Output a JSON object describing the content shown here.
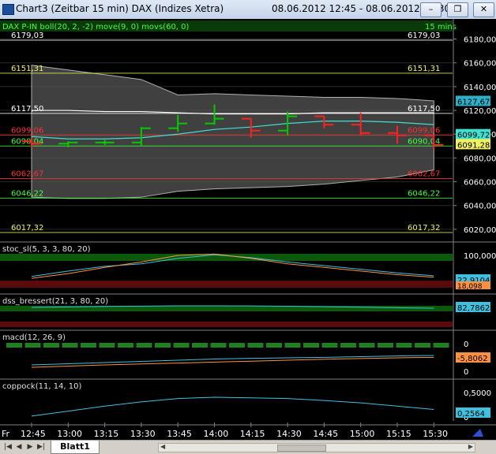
{
  "window": {
    "title": "Chart3 (Zeitbar 15 min)  DAX (Indizes Xetra)",
    "range": "08.06.2012 12:45 - 08.06.2012 15:30",
    "minimize_glyph": "–",
    "restore_glyph": "❐",
    "close_glyph": "✕"
  },
  "chart_header": {
    "label": "DAX P-IN  boll(20, 2, -2) move(9, 0) movs(60, 0)",
    "interval": "15 mins"
  },
  "colors": {
    "bg": "#000000",
    "grid": "#2a2a2a",
    "axis_text": "#ffffff",
    "up_bar": "#00cc00",
    "down_bar": "#ff2020",
    "boll_fill": "#555555",
    "ma9": "#40e0d0",
    "ma60": "#ffffff",
    "green_osc": "#0a5a0a",
    "red_osc": "#5a0a0a",
    "osc_cyan": "#40c0e0",
    "osc_orange": "#ff9040"
  },
  "chart_data": {
    "type": "candlestick",
    "x": [
      "12:45",
      "13:00",
      "13:15",
      "13:30",
      "13:45",
      "14:00",
      "14:15",
      "14:30",
      "14:45",
      "15:00",
      "15:15",
      "15:30"
    ],
    "ohlc": [
      [
        6094,
        6097,
        6089,
        6092
      ],
      [
        6092,
        6094,
        6089,
        6093
      ],
      [
        6093,
        6095,
        6091,
        6093
      ],
      [
        6093,
        6106,
        6090,
        6105
      ],
      [
        6105,
        6116,
        6102,
        6109
      ],
      [
        6109,
        6125,
        6108,
        6113
      ],
      [
        6113,
        6113,
        6097,
        6103
      ],
      [
        6103,
        6119,
        6099,
        6115
      ],
      [
        6115,
        6115,
        6105,
        6108
      ],
      [
        6108,
        6118,
        6099,
        6101
      ],
      [
        6101,
        6107,
        6092,
        6099
      ],
      [
        6099,
        6099,
        6088,
        6091
      ]
    ],
    "ylim": [
      6010,
      6185
    ],
    "y_ticks": [
      6020,
      6040,
      6060,
      6080,
      6100,
      6120,
      6140,
      6160,
      6180
    ],
    "y_tick_labels": [
      "6020,00",
      "6040,00",
      "6060,00",
      "6080,00",
      "6100,00",
      "6120,00",
      "6140,00",
      "6160,00",
      "6180,00"
    ],
    "boll_upper": [
      6158,
      6154,
      6150,
      6146,
      6133,
      6134,
      6133,
      6132,
      6131,
      6131,
      6130,
      6128
    ],
    "boll_lower": [
      6047,
      6046,
      6046,
      6047,
      6052,
      6054,
      6055,
      6056,
      6058,
      6061,
      6064,
      6070
    ],
    "ma9": [
      6098,
      6096,
      6096,
      6097,
      6100,
      6104,
      6106,
      6109,
      6111,
      6111,
      6110,
      6108
    ],
    "ma60": [
      6120,
      6120,
      6119,
      6119,
      6118,
      6117,
      6117,
      6117,
      6118,
      6118,
      6118,
      6118
    ],
    "levels": [
      {
        "value": 6179.03,
        "label": "6179,03",
        "color": "#ffffff"
      },
      {
        "value": 6151.31,
        "label": "6151,31",
        "color": "#f0f060"
      },
      {
        "value": 6117.5,
        "label": "6117,50",
        "color": "#ffffff"
      },
      {
        "value": 6099.06,
        "label": "6099,06",
        "color": "#ff3030"
      },
      {
        "value": 6090.04,
        "label": "6090,04",
        "color": "#40ff40"
      },
      {
        "value": 6062.67,
        "label": "6062,67",
        "color": "#ff3030"
      },
      {
        "value": 6046.22,
        "label": "6046,22",
        "color": "#40ff40"
      },
      {
        "value": 6017.32,
        "label": "6017,32",
        "color": "#f0f060"
      }
    ],
    "price_tags": [
      {
        "value": 6127.67,
        "label": "6127,67",
        "bg": "#30b0c8",
        "fg": "#000"
      },
      {
        "value": 6099.72,
        "label": "6099,72",
        "bg": "#40e0d0",
        "fg": "#000"
      },
      {
        "value": 6091.28,
        "label": "6091,28",
        "bg": "#f0f060",
        "fg": "#000"
      }
    ]
  },
  "panels": [
    {
      "name": "stoc",
      "label": "stoc_sl(5, 3, 3, 80, 20)",
      "ticks": [
        "100,0000"
      ],
      "tag": "22,9104",
      "tag_bg": "#40c0e0",
      "tag2": "18,098",
      "tag2_bg": "#ff9040"
    },
    {
      "name": "dss",
      "label": "dss_bressert(21, 3, 80, 20)",
      "ticks": [],
      "tag": "82,7862",
      "tag_bg": "#40c0e0"
    },
    {
      "name": "macd",
      "label": "macd(12, 26, 9)",
      "ticks": [
        "0",
        "0"
      ],
      "tag": "-5,8062",
      "tag_bg": "#ff9040"
    },
    {
      "name": "coppock",
      "label": "coppock(11, 14, 10)",
      "ticks": [
        "0,5000",
        "0"
      ],
      "tag": "0,2564",
      "tag_bg": "#40c0e0"
    }
  ],
  "x_axis": {
    "first_label": "Fr",
    "labels": [
      "12:45",
      "13:00",
      "13:15",
      "13:30",
      "13:45",
      "14:00",
      "14:15",
      "14:30",
      "14:45",
      "15:00",
      "15:15",
      "15:30"
    ]
  },
  "status": {
    "sheet_tab": "Blatt1"
  }
}
